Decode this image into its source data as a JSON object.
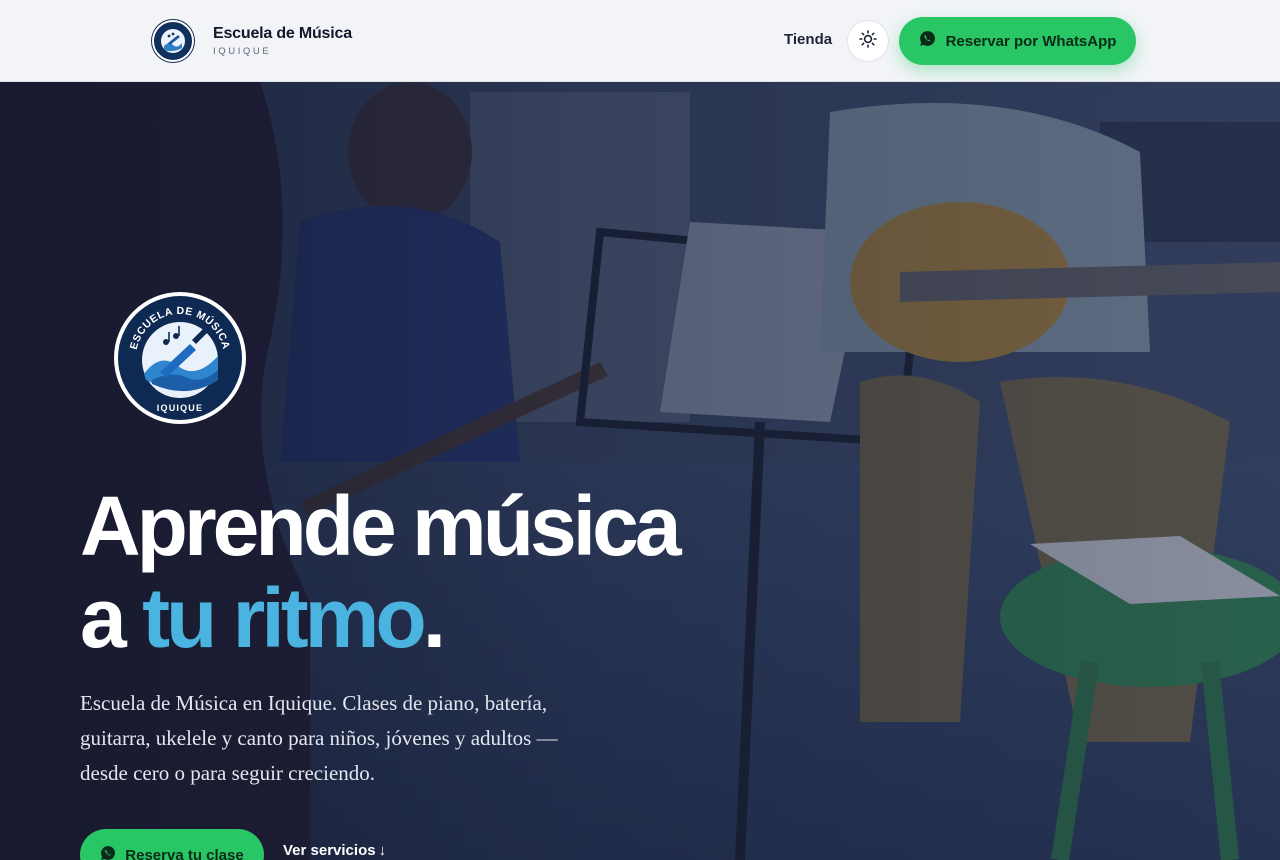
{
  "header": {
    "brand_name": "Escuela de Música",
    "brand_sub": "IQUIQUE",
    "nav_tienda": "Tienda",
    "theme_toggle_icon": "sun-icon",
    "whatsapp_button": "Reservar por WhatsApp",
    "whatsapp_icon": "whatsapp-icon"
  },
  "hero": {
    "logo_top_text": "ESCUELA DE MÚSICA",
    "logo_bottom_text": "IQUIQUE",
    "headline_line1": "Aprende música",
    "headline_line2_prefix": "a ",
    "headline_accent": "tu ritmo",
    "headline_suffix": ".",
    "subtext": "Escuela de Música en Iquique. Clases de piano, batería, guitarra, ukelele y canto para niños, jóvenes y adultos — desde cero o para seguir creciendo.",
    "cta_primary": "Reserva tu clase",
    "cta_secondary": "Ver servicios",
    "cta_secondary_arrow": "↓"
  },
  "colors": {
    "accent_blue": "#4ab3e0",
    "whatsapp_green": "#29c665",
    "header_bg": "#f2f4f8"
  }
}
